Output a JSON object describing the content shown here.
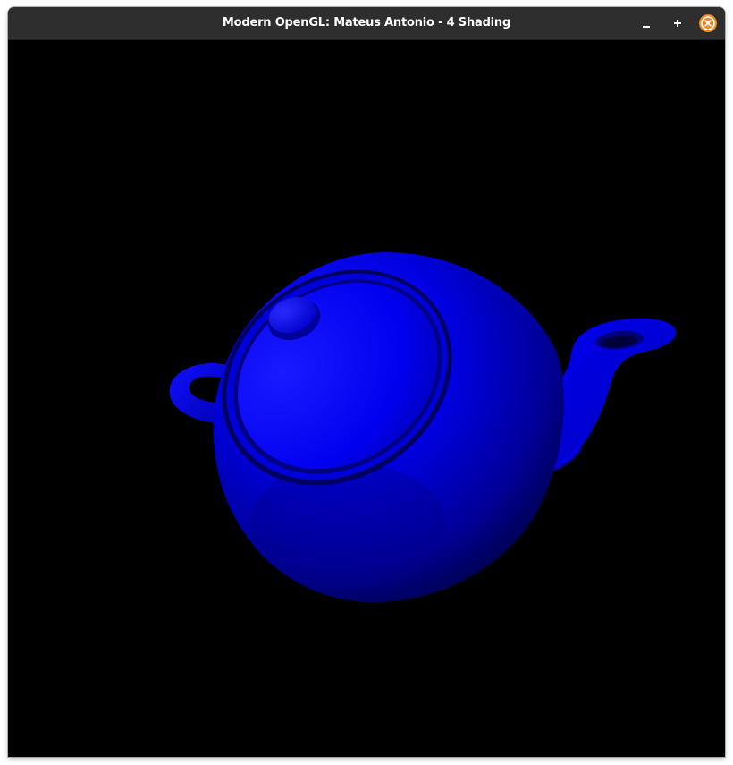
{
  "window": {
    "title": "Modern OpenGL: Mateus Antonio - 4 Shading"
  },
  "controls": {
    "minimize_icon": "minimize-icon",
    "maximize_icon": "maximize-icon",
    "close_icon": "close-icon"
  },
  "scene": {
    "object": "teapot",
    "background_color": "#000000",
    "object_color": "#0000ff"
  }
}
